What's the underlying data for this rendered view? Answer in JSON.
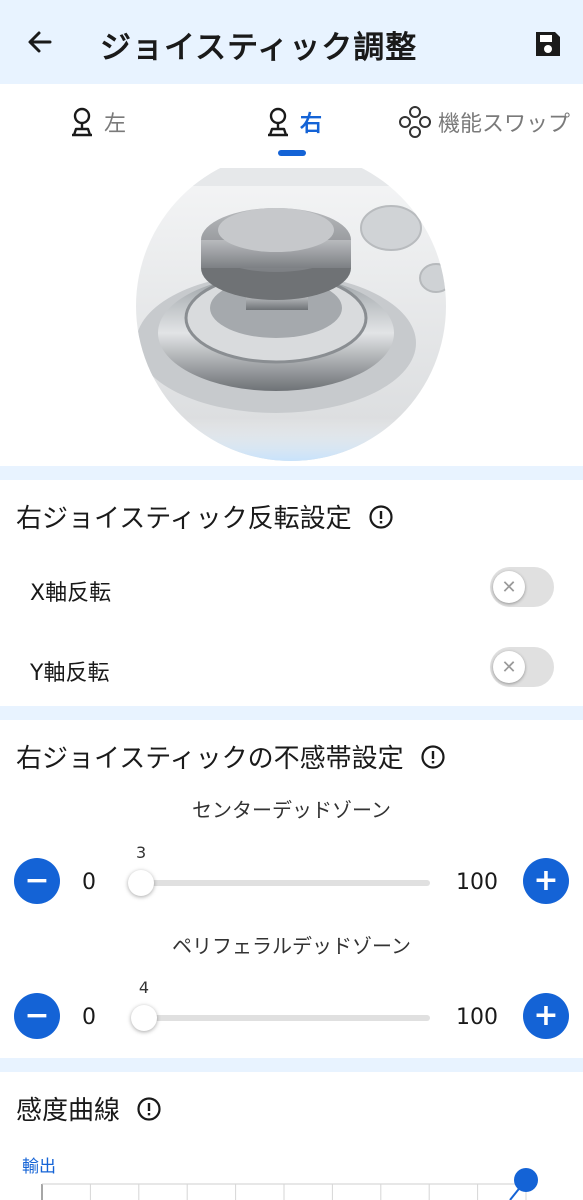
{
  "header": {
    "title": "ジョイスティック調整",
    "back_icon": "arrow-left-icon",
    "save_icon": "save-icon",
    "background": "#e8f3ff"
  },
  "tabs": [
    {
      "label": "左",
      "icon": "joystick-icon",
      "active": false
    },
    {
      "label": "右",
      "icon": "joystick-icon",
      "active": true
    },
    {
      "label": "機能スワップ",
      "icon": "dpad-icon",
      "active": false
    }
  ],
  "accent_color": "#1463d6",
  "invert_section": {
    "title": "右ジョイスティック反転設定",
    "info_icon": "info-icon",
    "rows": [
      {
        "label": "X軸反転",
        "enabled": false
      },
      {
        "label": "Y軸反転",
        "enabled": false
      }
    ]
  },
  "deadzone_section": {
    "title": "右ジョイスティックの不感帯設定",
    "info_icon": "info-icon",
    "sliders": [
      {
        "title": "センターデッドゾーン",
        "min": "0",
        "max": "100",
        "value": "3"
      },
      {
        "title": "ペリフェラルデッドゾーン",
        "min": "0",
        "max": "100",
        "value": "4"
      }
    ]
  },
  "curve_section": {
    "title": "感度曲線",
    "info_icon": "info-icon",
    "y_axis_label": "輸出"
  }
}
